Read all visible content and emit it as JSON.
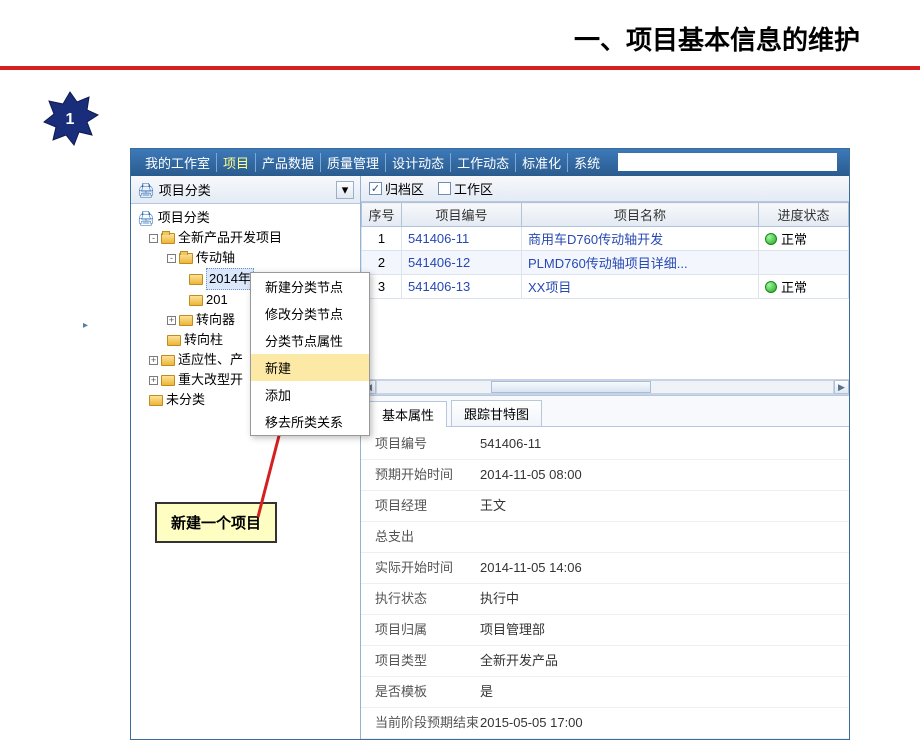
{
  "page": {
    "title": "一、项目基本信息的维护",
    "step_number": "1"
  },
  "menus": [
    "我的工作室",
    "项目",
    "产品数据",
    "质量管理",
    "设计动态",
    "工作动态",
    "标准化",
    "系统"
  ],
  "sidebar": {
    "header_label": "项目分类",
    "root_label": "项目分类",
    "nodes": [
      {
        "label": "全新产品开发项目",
        "indent": 1,
        "toggle": "-",
        "open": true
      },
      {
        "label": "传动轴",
        "indent": 2,
        "toggle": "-",
        "open": true
      },
      {
        "label": "2014年",
        "indent": 3,
        "toggle": "",
        "open": false,
        "partial": true
      },
      {
        "label": "201",
        "indent": 3,
        "toggle": "",
        "open": false
      },
      {
        "label": "转向器",
        "indent": 2,
        "toggle": "+",
        "open": false
      },
      {
        "label": "转向柱",
        "indent": 2,
        "toggle": "",
        "open": false
      },
      {
        "label": "适应性、产",
        "indent": 1,
        "toggle": "+",
        "open": false
      },
      {
        "label": "重大改型开",
        "indent": 1,
        "toggle": "+",
        "open": false
      },
      {
        "label": "未分类",
        "indent": 1,
        "toggle": "",
        "open": false
      }
    ]
  },
  "filters": {
    "archive_label": "归档区",
    "work_label": "工作区",
    "archive_checked": true,
    "work_checked": false
  },
  "grid": {
    "columns": [
      "序号",
      "项目编号",
      "项目名称",
      "进度状态"
    ],
    "rows": [
      {
        "idx": "1",
        "code": "541406-11",
        "name": "商用车D760传动轴开发",
        "status": "正常"
      },
      {
        "idx": "2",
        "code": "541406-12",
        "name": "PLMD760传动轴项目详细...",
        "status": ""
      },
      {
        "idx": "3",
        "code": "541406-13",
        "name": "XX项目",
        "status": "正常"
      }
    ]
  },
  "context_menu": {
    "items": [
      "新建分类节点",
      "修改分类节点",
      "分类节点属性",
      "新建",
      "添加",
      "移去所类关系"
    ],
    "hover_index": 3,
    "tooltip_label": "新建"
  },
  "callout_label": "新建一个项目",
  "tabs": {
    "items": [
      "基本属性",
      "跟踪甘特图"
    ],
    "active": 0
  },
  "form": {
    "rows": [
      {
        "label": "项目编号",
        "value": "541406-11"
      },
      {
        "label": "预期开始时间",
        "value": "2014-11-05 08:00"
      },
      {
        "label": "项目经理",
        "value": "王文"
      },
      {
        "label": "总支出",
        "value": ""
      },
      {
        "label": "实际开始时间",
        "value": "2014-11-05 14:06"
      },
      {
        "label": "执行状态",
        "value": "执行中"
      },
      {
        "label": "项目归属",
        "value": "项目管理部"
      },
      {
        "label": "项目类型",
        "value": "全新开发产品"
      },
      {
        "label": "是否模板",
        "value": "是"
      },
      {
        "label": "当前阶段预期结束",
        "value": "2015-05-05 17:00"
      }
    ]
  }
}
